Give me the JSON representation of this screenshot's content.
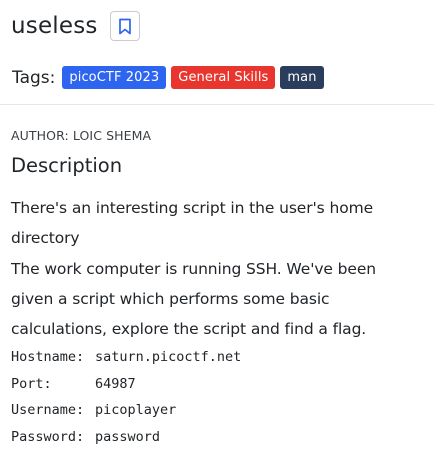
{
  "challenge": {
    "title": "useless"
  },
  "tags": {
    "label": "Tags:",
    "items": [
      {
        "label": "picoCTF 2023",
        "color": "#2d64f0"
      },
      {
        "label": "General Skills",
        "color": "#e8362f"
      },
      {
        "label": "man",
        "color": "#2b3d5c"
      }
    ]
  },
  "author": "AUTHOR: LOIC SHEMA",
  "description": {
    "heading": "Description",
    "paragraph1": "There's an interesting script in the user's home directory",
    "paragraph2": "The work computer is running SSH. We've been given a script which performs some basic calculations, explore the script and find a flag."
  },
  "credentials": [
    {
      "key": "Hostname:",
      "value": "saturn.picoctf.net"
    },
    {
      "key": "Port:",
      "value": "64987"
    },
    {
      "key": "Username:",
      "value": "picoplayer"
    },
    {
      "key": "Password:",
      "value": "password"
    }
  ],
  "icons": {
    "bookmark": "bookmark-icon"
  },
  "colors": {
    "bookmark": "#2d64f0"
  }
}
